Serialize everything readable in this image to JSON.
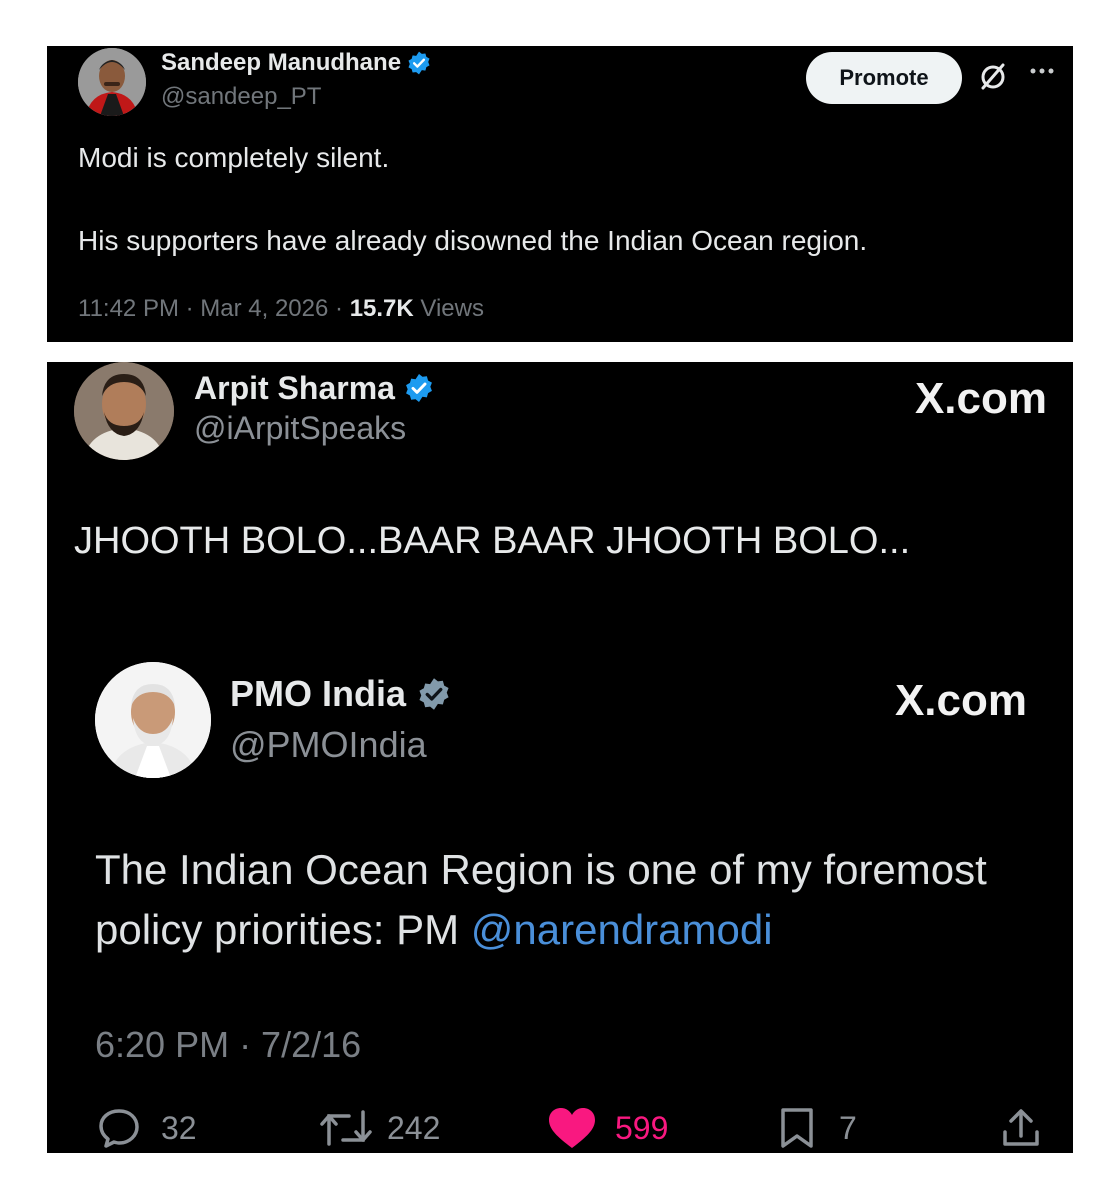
{
  "top_tweet": {
    "author_name": "Sandeep Manudhane",
    "handle": "@sandeep_PT",
    "promote_label": "Promote",
    "text_line1": "Modi is completely silent.",
    "text_line2": "His supporters have already disowned the Indian Ocean region.",
    "timestamp": "11:42 PM · Mar 4, 2026 · ",
    "views_count": "15.7K",
    "views_label": " Views"
  },
  "quoted_tweet": {
    "author_name": "Arpit Sharma",
    "handle": "@iArpitSpeaks",
    "watermark": "X.com",
    "text": "JHOOTH BOLO...BAAR BAAR JHOOTH BOLO...",
    "nested_tweet": {
      "author_name": "PMO India",
      "handle": "@PMOIndia",
      "watermark": "X.com",
      "text_line1": "The Indian Ocean Region is one of my foremost",
      "text_line2_prefix": "policy priorities: PM ",
      "mention": "@narendramodi",
      "timestamp": "6:20 PM · 7/2/16"
    },
    "stats": {
      "replies": "32",
      "retweets": "242",
      "likes": "599",
      "bookmarks": "7"
    }
  },
  "colors": {
    "background": "#000000",
    "verified_blue": "#1d9bf0",
    "verified_gray": "#829aab",
    "like_pink": "#f91880",
    "mention_blue": "#4a8fd9"
  },
  "icons": [
    "verified-badge-icon",
    "analytics-off-icon",
    "more-icon",
    "reply-icon",
    "retweet-icon",
    "heart-icon",
    "bookmark-icon",
    "share-icon"
  ]
}
